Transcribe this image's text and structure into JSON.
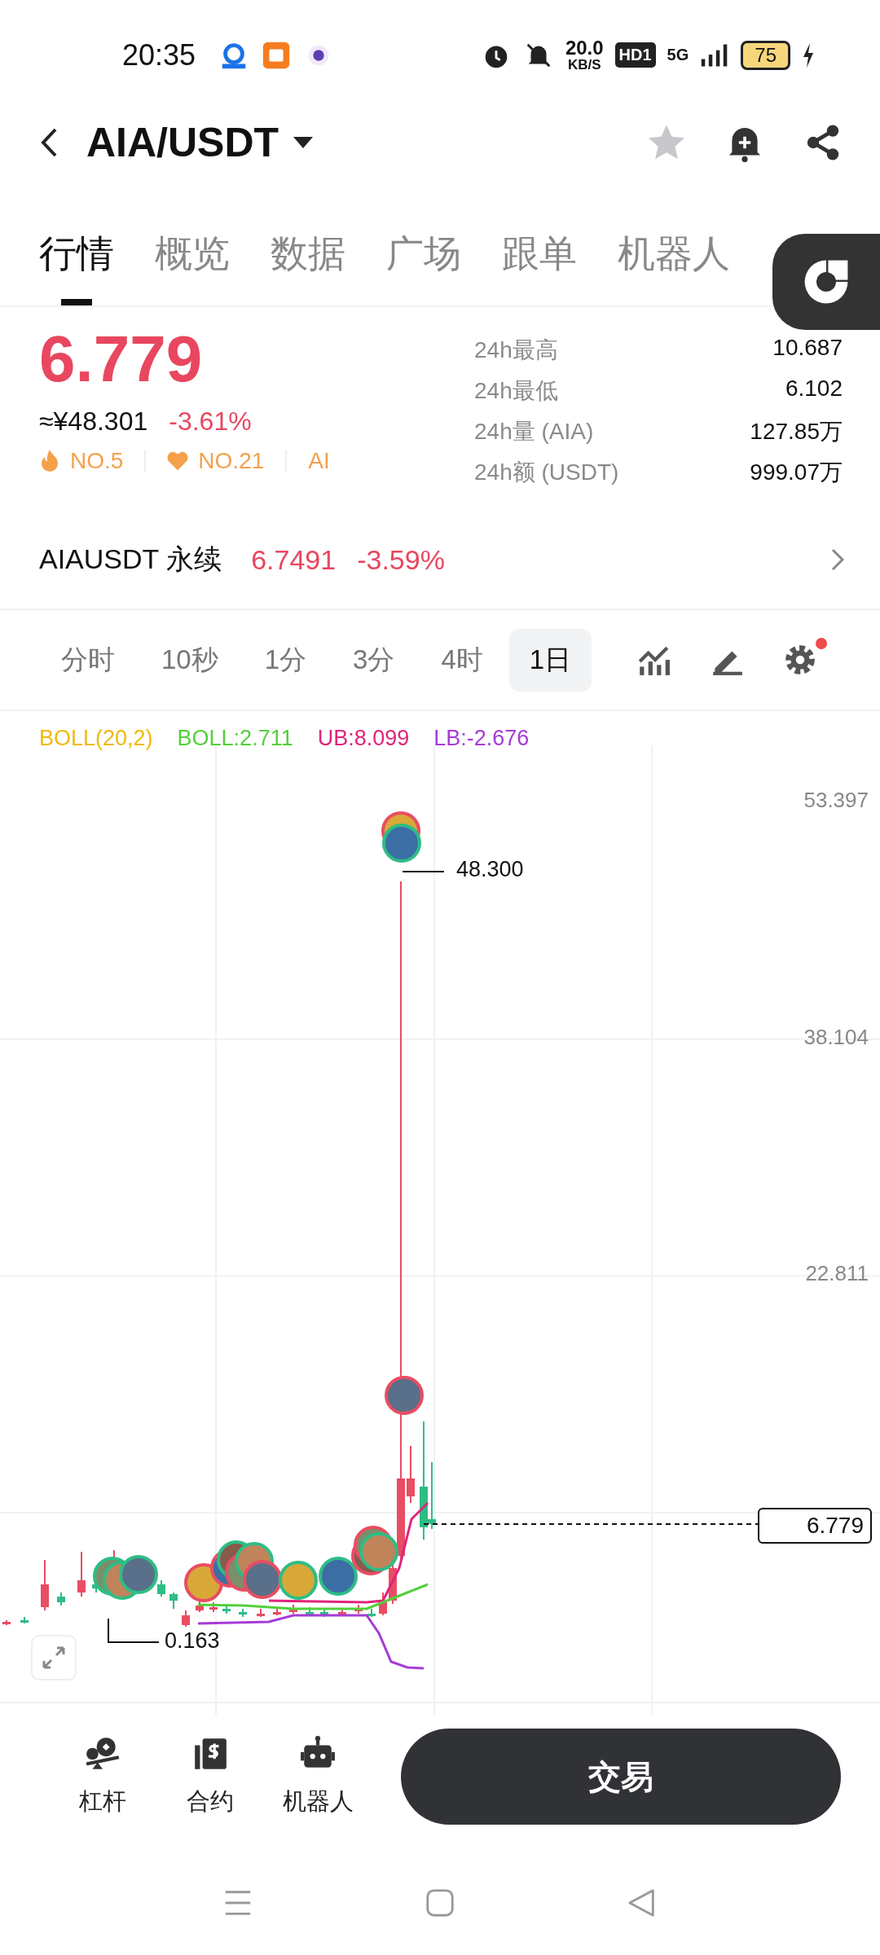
{
  "status_bar": {
    "time": "20:35",
    "speed_value": "20.0",
    "speed_unit": "KB/S",
    "hd": "HD1",
    "network": "5G",
    "battery": "75"
  },
  "header": {
    "title": "AIA/USDT"
  },
  "tabs": [
    {
      "label": "行情",
      "selected": true
    },
    {
      "label": "概览",
      "selected": false
    },
    {
      "label": "数据",
      "selected": false
    },
    {
      "label": "广场",
      "selected": false
    },
    {
      "label": "跟单",
      "selected": false
    },
    {
      "label": "机器人",
      "selected": false
    }
  ],
  "price": {
    "last": "6.779",
    "cny": "≈¥48.301",
    "change": "-3.61%",
    "tags": [
      {
        "kind": "hot",
        "label": "NO.5"
      },
      {
        "kind": "heart",
        "label": "NO.21"
      },
      {
        "kind": "plain",
        "label": "AI"
      }
    ]
  },
  "stats": [
    {
      "label": "24h最高",
      "value": "10.687"
    },
    {
      "label": "24h最低",
      "value": "6.102"
    },
    {
      "label": "24h量 (AIA)",
      "value": "127.85万"
    },
    {
      "label": "24h额 (USDT)",
      "value": "999.07万"
    }
  ],
  "perpetual": {
    "name": "AIAUSDT 永续",
    "price": "6.7491",
    "change": "-3.59%"
  },
  "timeframes": [
    {
      "label": "分时",
      "selected": false
    },
    {
      "label": "10秒",
      "selected": false
    },
    {
      "label": "1分",
      "selected": false
    },
    {
      "label": "3分",
      "selected": false
    },
    {
      "label": "4时",
      "selected": false
    },
    {
      "label": "1日",
      "selected": true
    }
  ],
  "settings_dot": true,
  "indicators": [
    {
      "label": "BOLL(20,2)",
      "color": "#f0b90b"
    },
    {
      "label": "BOLL:2.711",
      "color": "#52d03a"
    },
    {
      "label": "UB:8.099",
      "color": "#e0247a"
    },
    {
      "label": "LB:-2.676",
      "color": "#a63cd6"
    }
  ],
  "chart": {
    "y_labels": [
      "53.397",
      "38.104",
      "22.811"
    ],
    "high_label": "48.300",
    "low_label": "0.163",
    "last_price": "6.779"
  },
  "actions": [
    {
      "kind": "lever",
      "label": "杠杆"
    },
    {
      "kind": "contract",
      "label": "合约"
    },
    {
      "kind": "robot",
      "label": "机器人"
    }
  ],
  "trade_button": "交易"
}
